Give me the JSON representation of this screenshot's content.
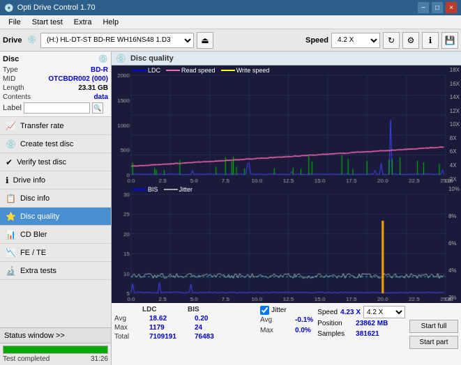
{
  "app": {
    "title": "Opti Drive Control 1.70",
    "icon": "💿"
  },
  "titlebar": {
    "title": "Opti Drive Control 1.70",
    "minimize_label": "−",
    "maximize_label": "□",
    "close_label": "×"
  },
  "menubar": {
    "items": [
      "File",
      "Start test",
      "Extra",
      "Help"
    ]
  },
  "toolbar": {
    "drive_label": "Drive",
    "drive_value": "(H:) HL-DT-ST BD-RE  WH16NS48 1.D3",
    "speed_label": "Speed",
    "speed_value": "4.2 X"
  },
  "disc_panel": {
    "title": "Disc",
    "type_label": "Type",
    "type_value": "BD-R",
    "mid_label": "MID",
    "mid_value": "OTCBDR002 (000)",
    "length_label": "Length",
    "length_value": "23.31 GB",
    "contents_label": "Contents",
    "contents_value": "data",
    "label_label": "Label",
    "label_value": ""
  },
  "nav": {
    "items": [
      {
        "id": "transfer-rate",
        "label": "Transfer rate",
        "icon": "📈"
      },
      {
        "id": "create-test-disc",
        "label": "Create test disc",
        "icon": "💿"
      },
      {
        "id": "verify-test-disc",
        "label": "Verify test disc",
        "icon": "✔"
      },
      {
        "id": "drive-info",
        "label": "Drive info",
        "icon": "ℹ"
      },
      {
        "id": "disc-info",
        "label": "Disc info",
        "icon": "📋"
      },
      {
        "id": "disc-quality",
        "label": "Disc quality",
        "icon": "⭐",
        "active": true
      },
      {
        "id": "cd-bler",
        "label": "CD Bler",
        "icon": "📊"
      },
      {
        "id": "fe-te",
        "label": "FE / TE",
        "icon": "📉"
      },
      {
        "id": "extra-tests",
        "label": "Extra tests",
        "icon": "🔬"
      }
    ]
  },
  "status": {
    "window_btn": "Status window >>",
    "progress": 100,
    "status_text": "Test completed",
    "time": "31:26"
  },
  "disc_quality": {
    "title": "Disc quality",
    "chart_top": {
      "legend": [
        {
          "label": "LDC",
          "color": "#0000ff"
        },
        {
          "label": "Read speed",
          "color": "#ff69b4"
        },
        {
          "label": "Write speed",
          "color": "#ffff00"
        }
      ],
      "y_left": [
        "2000",
        "1500",
        "1000",
        "500",
        "0"
      ],
      "y_right": [
        "18X",
        "16X",
        "14X",
        "12X",
        "10X",
        "8X",
        "6X",
        "4X",
        "2X"
      ],
      "x_labels": [
        "0.0",
        "2.5",
        "5.0",
        "7.5",
        "10.0",
        "12.5",
        "15.0",
        "17.5",
        "20.0",
        "22.5",
        "25.0 GB"
      ]
    },
    "chart_bottom": {
      "legend": [
        {
          "label": "BIS",
          "color": "#0000ff"
        },
        {
          "label": "Jitter",
          "color": "#888888"
        }
      ],
      "y_left": [
        "30",
        "25",
        "20",
        "15",
        "10",
        "5"
      ],
      "y_right": [
        "10%",
        "8%",
        "6%",
        "4%",
        "2%"
      ],
      "x_labels": [
        "0.0",
        "2.5",
        "5.0",
        "7.5",
        "10.0",
        "12.5",
        "15.0",
        "17.5",
        "20.0",
        "22.5",
        "25.0 GB"
      ]
    }
  },
  "stats": {
    "headers": [
      "",
      "LDC",
      "BIS"
    ],
    "avg_label": "Avg",
    "avg_ldc": "18.62",
    "avg_bis": "0.20",
    "max_label": "Max",
    "max_ldc": "1179",
    "max_bis": "24",
    "total_label": "Total",
    "total_ldc": "7109191",
    "total_bis": "76483",
    "jitter_label": "Jitter",
    "jitter_avg": "-0.1%",
    "jitter_max": "0.0%",
    "jitter_total": "",
    "speed_label": "Speed",
    "speed_value": "4.23 X",
    "speed_select": "4.2 X",
    "position_label": "Position",
    "position_value": "23862 MB",
    "samples_label": "Samples",
    "samples_value": "381621",
    "start_full_label": "Start full",
    "start_part_label": "Start part"
  }
}
